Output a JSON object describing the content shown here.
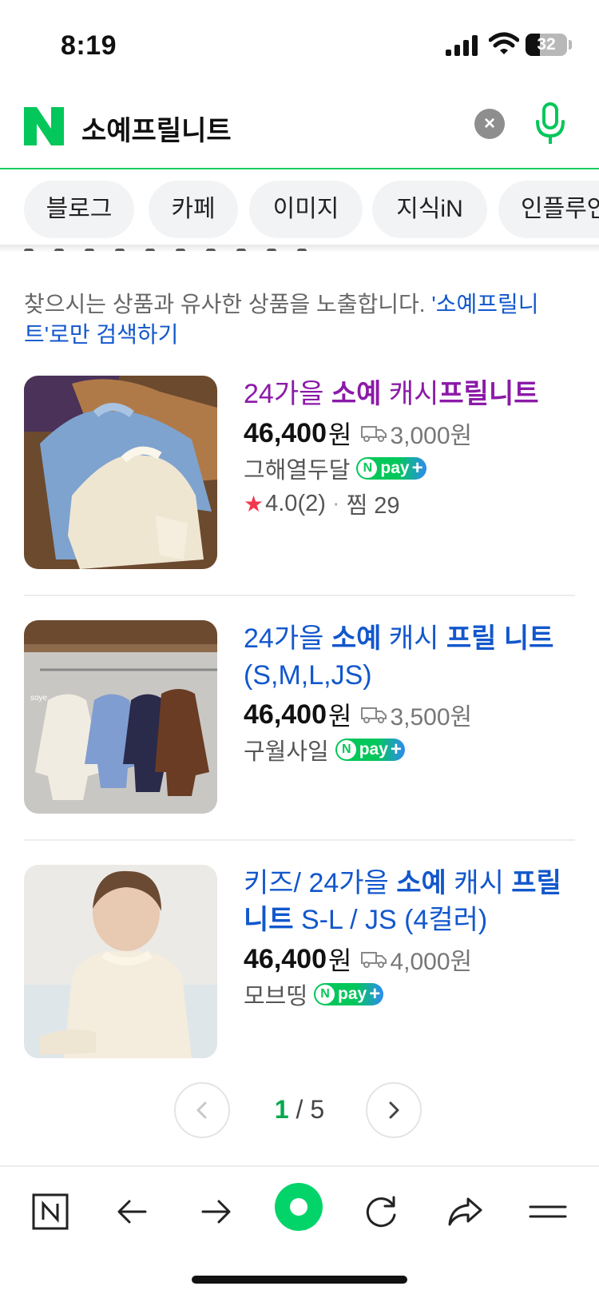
{
  "status_bar": {
    "time": "8:19",
    "battery": "32"
  },
  "search": {
    "query": "소예프릴니트",
    "clear_icon": "close-icon",
    "mic_icon": "microphone-icon",
    "accent": "#19ce60"
  },
  "tabs": [
    "블로그",
    "카페",
    "이미지",
    "지식iN",
    "인플루언"
  ],
  "notice": {
    "text": "찾으시는 상품과 유사한 상품을 노출합니다. ",
    "link": "'소예프릴니트'로만 검색하기"
  },
  "products": [
    {
      "title_pre": "24가을 ",
      "title_bold1": "소예",
      "title_mid": " 캐시",
      "title_bold2": "프릴니트",
      "title_post": "",
      "price": "46,400",
      "unit": "원",
      "shipping": "3,000원",
      "seller": "그해열두달",
      "npay": "pay",
      "rating": "4.0",
      "reviews": "(2)",
      "wish": "찜 29"
    },
    {
      "title_pre": "24가을 ",
      "title_bold1": "소예",
      "title_mid": " 캐시 ",
      "title_bold2": "프릴 니트",
      "title_post": " (S,M,L,JS)",
      "price": "46,400",
      "unit": "원",
      "shipping": "3,500원",
      "seller": "구월사일",
      "npay": "pay"
    },
    {
      "title_pre": "키즈/ 24가을 ",
      "title_bold1": "소예",
      "title_mid": " 캐시 ",
      "title_bold2": "프릴니트",
      "title_post": " S-L / JS (4컬러)",
      "price": "46,400",
      "unit": "원",
      "shipping": "4,000원",
      "seller": "모브띵",
      "npay": "pay"
    }
  ],
  "pagination": {
    "current": "1",
    "sep": " / ",
    "total": "5"
  },
  "toolbar": [
    "naver-home-icon",
    "back-arrow-icon",
    "forward-arrow-icon",
    "green-dot-icon",
    "refresh-icon",
    "share-icon",
    "menu-icon"
  ]
}
